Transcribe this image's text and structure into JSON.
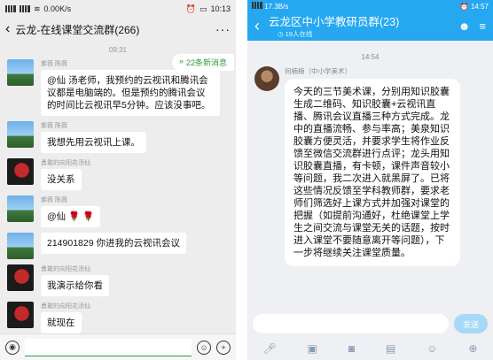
{
  "left": {
    "status": {
      "speed": "0.00K/s",
      "time": "10:13"
    },
    "nav": {
      "title": "云龙-在线课堂交流群(266)",
      "more": "···"
    },
    "time": "09:31",
    "new_messages": "22条新消息",
    "messages": [
      {
        "nick": "紫薇  陈薇",
        "text": "@仙  汤老师，我预约的云视讯和腾讯会议都是电脑端的。但是预约的腾讯会议的时间比云视讯早5分钟。应该没事吧。",
        "avatar": "sky"
      },
      {
        "nick": "紫薇  陈薇",
        "text": "我想先用云视讯上课。",
        "avatar": "sky"
      },
      {
        "nick": "勇敢的向阳花汤仙",
        "text": "没关系",
        "avatar": "red"
      },
      {
        "nick": "紫薇  陈薇",
        "text": "@仙  🌹 🌹",
        "avatar": "sky"
      },
      {
        "nick": "",
        "text": "214901829 你进我的云视讯会议",
        "link": "214901829",
        "avatar": "sky"
      },
      {
        "nick": "勇敢的向阳花汤仙",
        "text": "我演示给你看",
        "avatar": "red"
      },
      {
        "nick": "勇敢的向阳花汤仙",
        "text": "就现在",
        "avatar": "red"
      }
    ],
    "input_icons": [
      "voice-icon",
      "emoji-icon",
      "plus-icon"
    ]
  },
  "right": {
    "status": {
      "speed": "17.3B/s",
      "time": "14:57"
    },
    "nav": {
      "title": "云龙区中小学教研员群(23)",
      "online": "19人在线"
    },
    "time": "14:54",
    "message": {
      "nick": "何楠楠（中小学美术）",
      "text": "今天的三节美术课，分别用知识胶囊生成二维码、知识胶囊+云视讯直播、腾讯会议直播三种方式完成。龙中的直播流畅、参与率高；美泉知识胶囊方便灵活，并要求学生将作业反馈至微信交流群进行点评；龙头用知识胶囊直播，有卡顿，课件声音较小等问题，我二次进入就黑屏了。已将这些情况反馈至学科教师群，要求老师们筛选好上课方式并加强对课堂的把握（如提前沟通好，杜绝课堂上学生之间交流与课堂无关的话题，按时进入课堂不要随意离开等问题），下一步将继续关注课堂质量。"
    },
    "send": "发送",
    "tools": [
      "mic-icon",
      "image-icon",
      "camera-icon",
      "folder-icon",
      "emoji-icon",
      "plus-icon"
    ]
  }
}
